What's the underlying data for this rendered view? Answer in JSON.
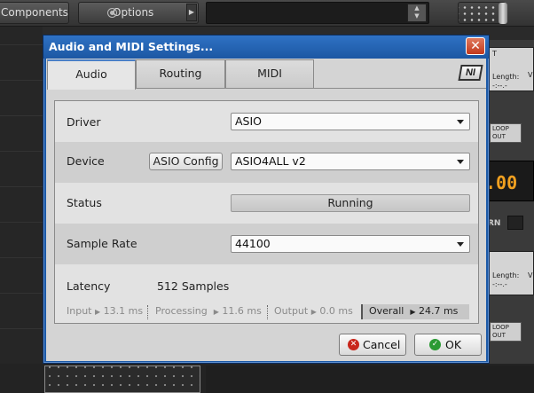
{
  "host": {
    "components_label": "Components",
    "options_label": "Options",
    "right_panel": {
      "length_label_1": "Length:",
      "length_value_1": "-:--.-",
      "loop_1": "LOOP\nOUT",
      "display_value": ".00",
      "rn_label": "RN",
      "length_label_2": "Length:",
      "length_value_2": "-:--.-",
      "loop_2": "LOOP\nOUT",
      "letter_t": "T",
      "letter_v1": "V",
      "letter_v2": "V"
    }
  },
  "dialog": {
    "title": "Audio and MIDI Settings...",
    "close_symbol": "✕",
    "logo_text": "NI",
    "tabs": [
      {
        "label": "Audio",
        "active": true
      },
      {
        "label": "Routing",
        "active": false
      },
      {
        "label": "MIDI",
        "active": false
      }
    ],
    "driver": {
      "label": "Driver",
      "value": "ASIO"
    },
    "device": {
      "label": "Device",
      "config_button": "ASIO Config",
      "value": "ASIO4ALL v2"
    },
    "status": {
      "label": "Status",
      "value": "Running"
    },
    "sample_rate": {
      "label": "Sample Rate",
      "value": "44100"
    },
    "latency": {
      "label": "Latency",
      "value": "512 Samples",
      "input_label": "Input",
      "input_value": "13.1 ms",
      "processing_label": "Processing",
      "processing_value": "11.6 ms",
      "output_label": "Output",
      "output_value": "0.0 ms",
      "overall_label": "Overall",
      "overall_value": "24.7 ms"
    },
    "buttons": {
      "cancel": "Cancel",
      "ok": "OK"
    }
  }
}
